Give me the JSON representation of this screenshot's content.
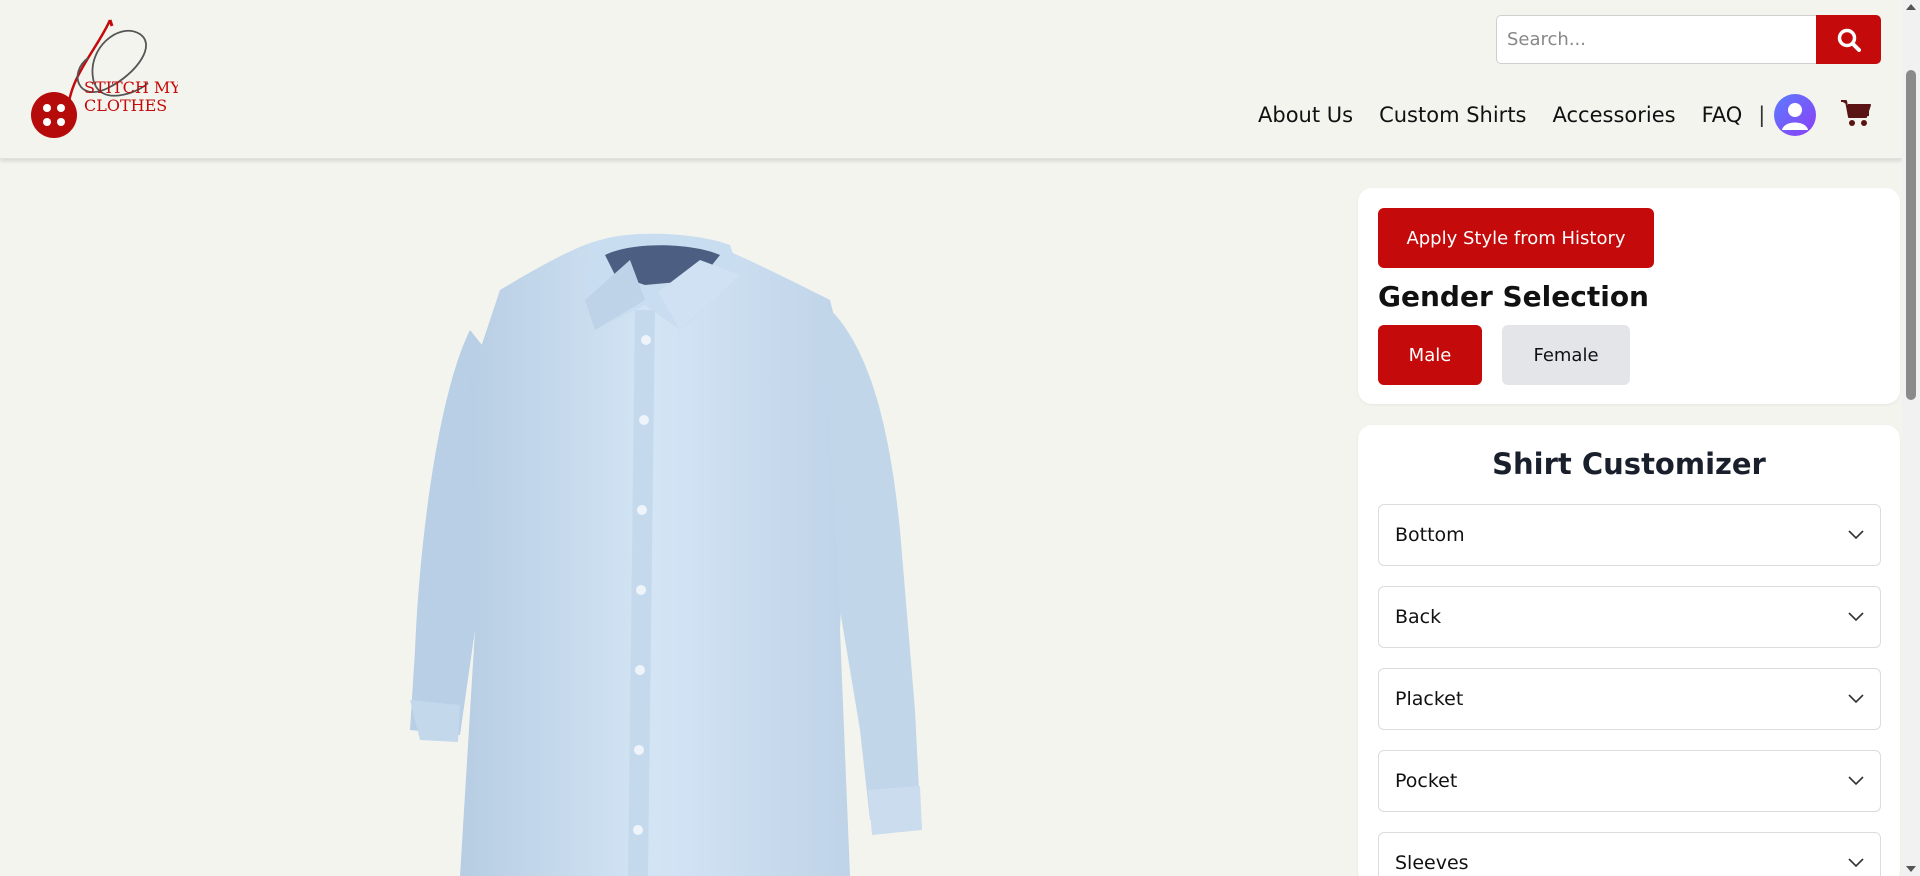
{
  "brand": {
    "logo_line1": "STITCH MY",
    "logo_line2": "CLOTHES",
    "accent_color": "#c40a0a"
  },
  "search": {
    "placeholder": "Search...",
    "button_icon": "search-icon"
  },
  "nav": {
    "items": [
      {
        "label": "About Us"
      },
      {
        "label": "Custom Shirts"
      },
      {
        "label": "Accessories"
      },
      {
        "label": "FAQ"
      }
    ],
    "separator": "|",
    "user_icon": "user-avatar-icon",
    "cart_icon": "cart-icon"
  },
  "gender_panel": {
    "apply_button": "Apply Style from History",
    "title": "Gender Selection",
    "options": [
      {
        "label": "Male",
        "selected": true
      },
      {
        "label": "Female",
        "selected": false
      }
    ]
  },
  "customizer": {
    "title": "Shirt Customizer",
    "sections": [
      {
        "label": "Bottom"
      },
      {
        "label": "Back"
      },
      {
        "label": "Placket"
      },
      {
        "label": "Pocket"
      },
      {
        "label": "Sleeves"
      }
    ]
  },
  "preview": {
    "image_icon": "shirt-preview-image",
    "shirt_color": "#c8dcef"
  }
}
